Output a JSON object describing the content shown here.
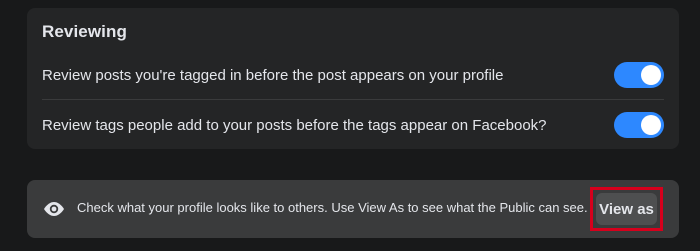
{
  "reviewing": {
    "title": "Reviewing",
    "settings": [
      {
        "label": "Review posts you're tagged in before the post appears on your profile",
        "enabled": true
      },
      {
        "label": "Review tags people add to your posts before the tags appear on Facebook?",
        "enabled": true
      }
    ]
  },
  "view_as": {
    "icon": "eye-icon",
    "info_text": "Check what your profile looks like to others. Use View As to see what the Public can see.",
    "button_label": "View as"
  },
  "colors": {
    "background": "#18191a",
    "card": "#242526",
    "info_card": "#3a3b3c",
    "toggle_on": "#2d88ff",
    "highlight": "#d6001c"
  }
}
